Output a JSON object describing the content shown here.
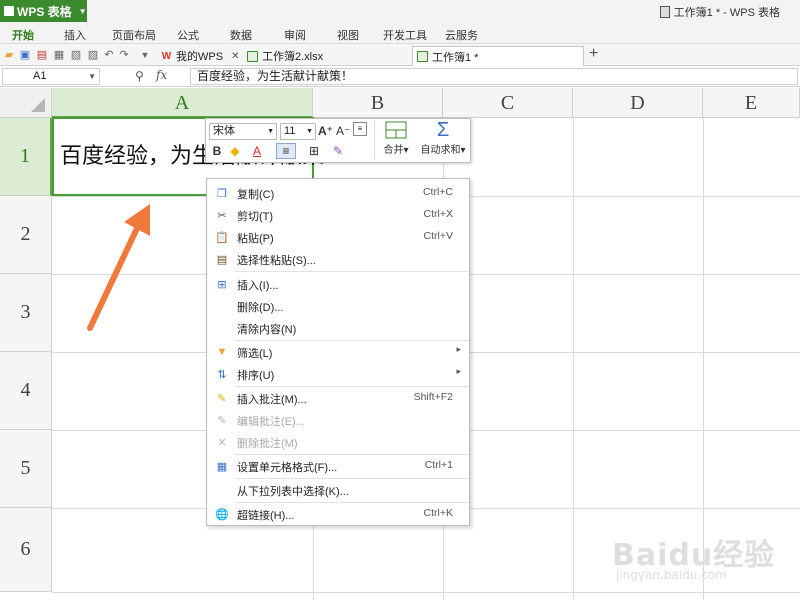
{
  "app": {
    "name": "WPS 表格",
    "window_title": "工作簿1 * - WPS 表格"
  },
  "menu": [
    "开始",
    "插入",
    "页面布局",
    "公式",
    "数据",
    "审阅",
    "视图",
    "开发工具",
    "云服务"
  ],
  "tabs": [
    {
      "label": "我的WPS",
      "icon": "wps-logo-icon"
    },
    {
      "label": "工作簿2.xlsx",
      "icon": "sheet-icon"
    },
    {
      "label": "工作簿1 *",
      "icon": "sheet-icon",
      "active": true
    }
  ],
  "formula_bar": {
    "name_box": "A1",
    "fx": "fx",
    "content": "百度经验，为生活献计献策！"
  },
  "columns": [
    "A",
    "B",
    "C",
    "D",
    "E"
  ],
  "rows": [
    "1",
    "2",
    "3",
    "4",
    "5",
    "6"
  ],
  "cell_a1": "百度经验，为生活献计献策！",
  "mini_toolbar": {
    "font": "宋体",
    "size": "11",
    "merge_label": "合并",
    "autosum_label": "自动求和"
  },
  "context_menu": [
    {
      "label": "复制(C)",
      "shortcut": "Ctrl+C",
      "icon": "copy-icon"
    },
    {
      "label": "剪切(T)",
      "shortcut": "Ctrl+X",
      "icon": "cut-icon"
    },
    {
      "label": "粘贴(P)",
      "shortcut": "Ctrl+V",
      "icon": "paste-icon"
    },
    {
      "label": "选择性粘贴(S)...",
      "shortcut": "",
      "icon": "paste-special-icon"
    },
    {
      "label": "插入(I)...",
      "shortcut": "",
      "icon": "insert-icon"
    },
    {
      "label": "删除(D)...",
      "shortcut": "",
      "icon": ""
    },
    {
      "label": "清除内容(N)",
      "shortcut": "",
      "icon": ""
    },
    {
      "label": "筛选(L)",
      "shortcut": "",
      "icon": "filter-icon",
      "submenu": true
    },
    {
      "label": "排序(U)",
      "shortcut": "",
      "icon": "sort-icon",
      "submenu": true
    },
    {
      "label": "插入批注(M)...",
      "shortcut": "Shift+F2",
      "icon": "insert-comment-icon"
    },
    {
      "label": "编辑批注(E)...",
      "shortcut": "",
      "icon": "edit-comment-icon",
      "disabled": true
    },
    {
      "label": "删除批注(M)",
      "shortcut": "",
      "icon": "delete-comment-icon",
      "disabled": true
    },
    {
      "label": "设置单元格格式(F)...",
      "shortcut": "Ctrl+1",
      "icon": "format-cells-icon"
    },
    {
      "label": "从下拉列表中选择(K)...",
      "shortcut": "",
      "icon": ""
    },
    {
      "label": "超链接(H)...",
      "shortcut": "Ctrl+K",
      "icon": "hyperlink-icon"
    }
  ],
  "watermark": {
    "logo": "Baidu经验",
    "url": "jingyan.baidu.com"
  },
  "colors": {
    "accent": "#3c8a2e",
    "selection": "#dcebd3",
    "arrow": "#f07a3c"
  }
}
